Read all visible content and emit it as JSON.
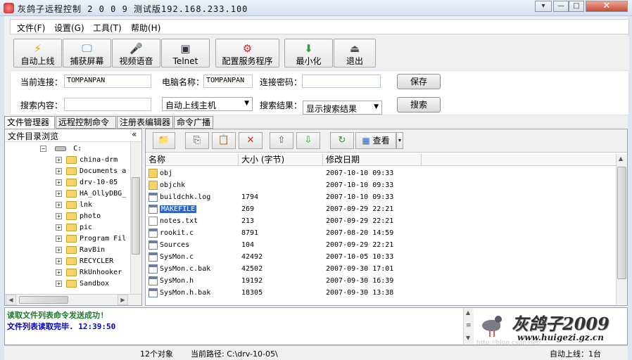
{
  "window": {
    "title": "灰鸽子远程控制 2 0 0 9 测试版192.168.233.100",
    "close": "✕",
    "max": "□",
    "min": "—",
    "menu": "▾"
  },
  "menubar": [
    "文件(F)",
    "设置(G)",
    "工具(T)",
    "帮助(H)"
  ],
  "toolbar": [
    {
      "label": "自动上线",
      "icon": "auto-online-icon",
      "glyph": "⚡"
    },
    {
      "label": "捕获屏幕",
      "icon": "capture-screen-icon",
      "glyph": "🖵"
    },
    {
      "label": "视频语音",
      "icon": "video-voice-icon",
      "glyph": "🎤"
    },
    {
      "label": "Telnet",
      "icon": "telnet-icon",
      "glyph": "▣"
    },
    {
      "label": "配置服务程序",
      "icon": "config-server-icon",
      "glyph": "⚙"
    },
    {
      "label": "最小化",
      "icon": "minimize-icon",
      "glyph": "⬇"
    },
    {
      "label": "退出",
      "icon": "exit-icon",
      "glyph": "⏏"
    }
  ],
  "form": {
    "current_conn_label": "当前连接：",
    "current_conn_value": "TOMPANPAN",
    "computer_name_label": "电脑名称：",
    "computer_name_value": "TOMPANPAN",
    "password_label": "连接密码：",
    "password_value": "",
    "save": "保存",
    "search_label": "搜索内容：",
    "search_value": "",
    "auto_host": "自动上线主机",
    "result_label": "搜索结果：",
    "result_value": "显示搜索结果",
    "search_btn": "搜索"
  },
  "tabs": [
    "文件管理器",
    "远程控制命令",
    "注册表编辑器",
    "命令广播"
  ],
  "tree": {
    "header": "文件目录浏览",
    "collapse": "«",
    "root": "C:",
    "items": [
      "china-drm",
      "Documents a",
      "drv-10-05",
      "HA_OllyDBG_",
      "lnk",
      "photo",
      "pic",
      "Program Fil",
      "RavBin",
      "RECYCLER",
      "RkUnhooker",
      "Sandbox"
    ]
  },
  "file_tools": {
    "view_label": "查看"
  },
  "file_list": {
    "columns": [
      "名称",
      "大小 (字节)",
      "修改日期"
    ],
    "rows": [
      {
        "name": "obj",
        "size": "",
        "date": "2007-10-10 09:33",
        "type": "dir"
      },
      {
        "name": "objchk",
        "size": "",
        "date": "2007-10-10 09:33",
        "type": "dir"
      },
      {
        "name": "buildchk.log",
        "size": "1794",
        "date": "2007-10-10 09:33",
        "type": "doc"
      },
      {
        "name": "MAKEFILE",
        "size": "269",
        "date": "2007-09-29 22:21",
        "type": "doc"
      },
      {
        "name": "notes.txt",
        "size": "213",
        "date": "2007-09-29 22:21",
        "type": "txt"
      },
      {
        "name": "rookit.c",
        "size": "8791",
        "date": "2007-08-20 14:59",
        "type": "doc"
      },
      {
        "name": "Sources",
        "size": "104",
        "date": "2007-09-29 22:21",
        "type": "doc"
      },
      {
        "name": "SysMon.c",
        "size": "42492",
        "date": "2007-10-05 10:33",
        "type": "doc"
      },
      {
        "name": "SysMon.c.bak",
        "size": "42502",
        "date": "2007-09-30 17:01",
        "type": "doc"
      },
      {
        "name": "SysMon.h",
        "size": "19192",
        "date": "2007-09-30 16:39",
        "type": "doc"
      },
      {
        "name": "SysMon.h.bak",
        "size": "18305",
        "date": "2007-09-30 13:38",
        "type": "doc"
      }
    ]
  },
  "log": [
    "读取文件列表命令发送成功!",
    "文件列表读取完毕. 12:39:50"
  ],
  "logo": {
    "text": "灰鸽子2009",
    "url": "www.huigezi.gz.cn",
    "watermark": "http://blog.csdn.net/"
  },
  "status": {
    "count": "12个对象",
    "path": "当前路径: C:\\drv-10-05\\",
    "online": "自动上线：1台"
  },
  "colors": {
    "accent": "#3168c6",
    "log_green": "#1a7a2a",
    "log_blue": "#0000cc"
  }
}
